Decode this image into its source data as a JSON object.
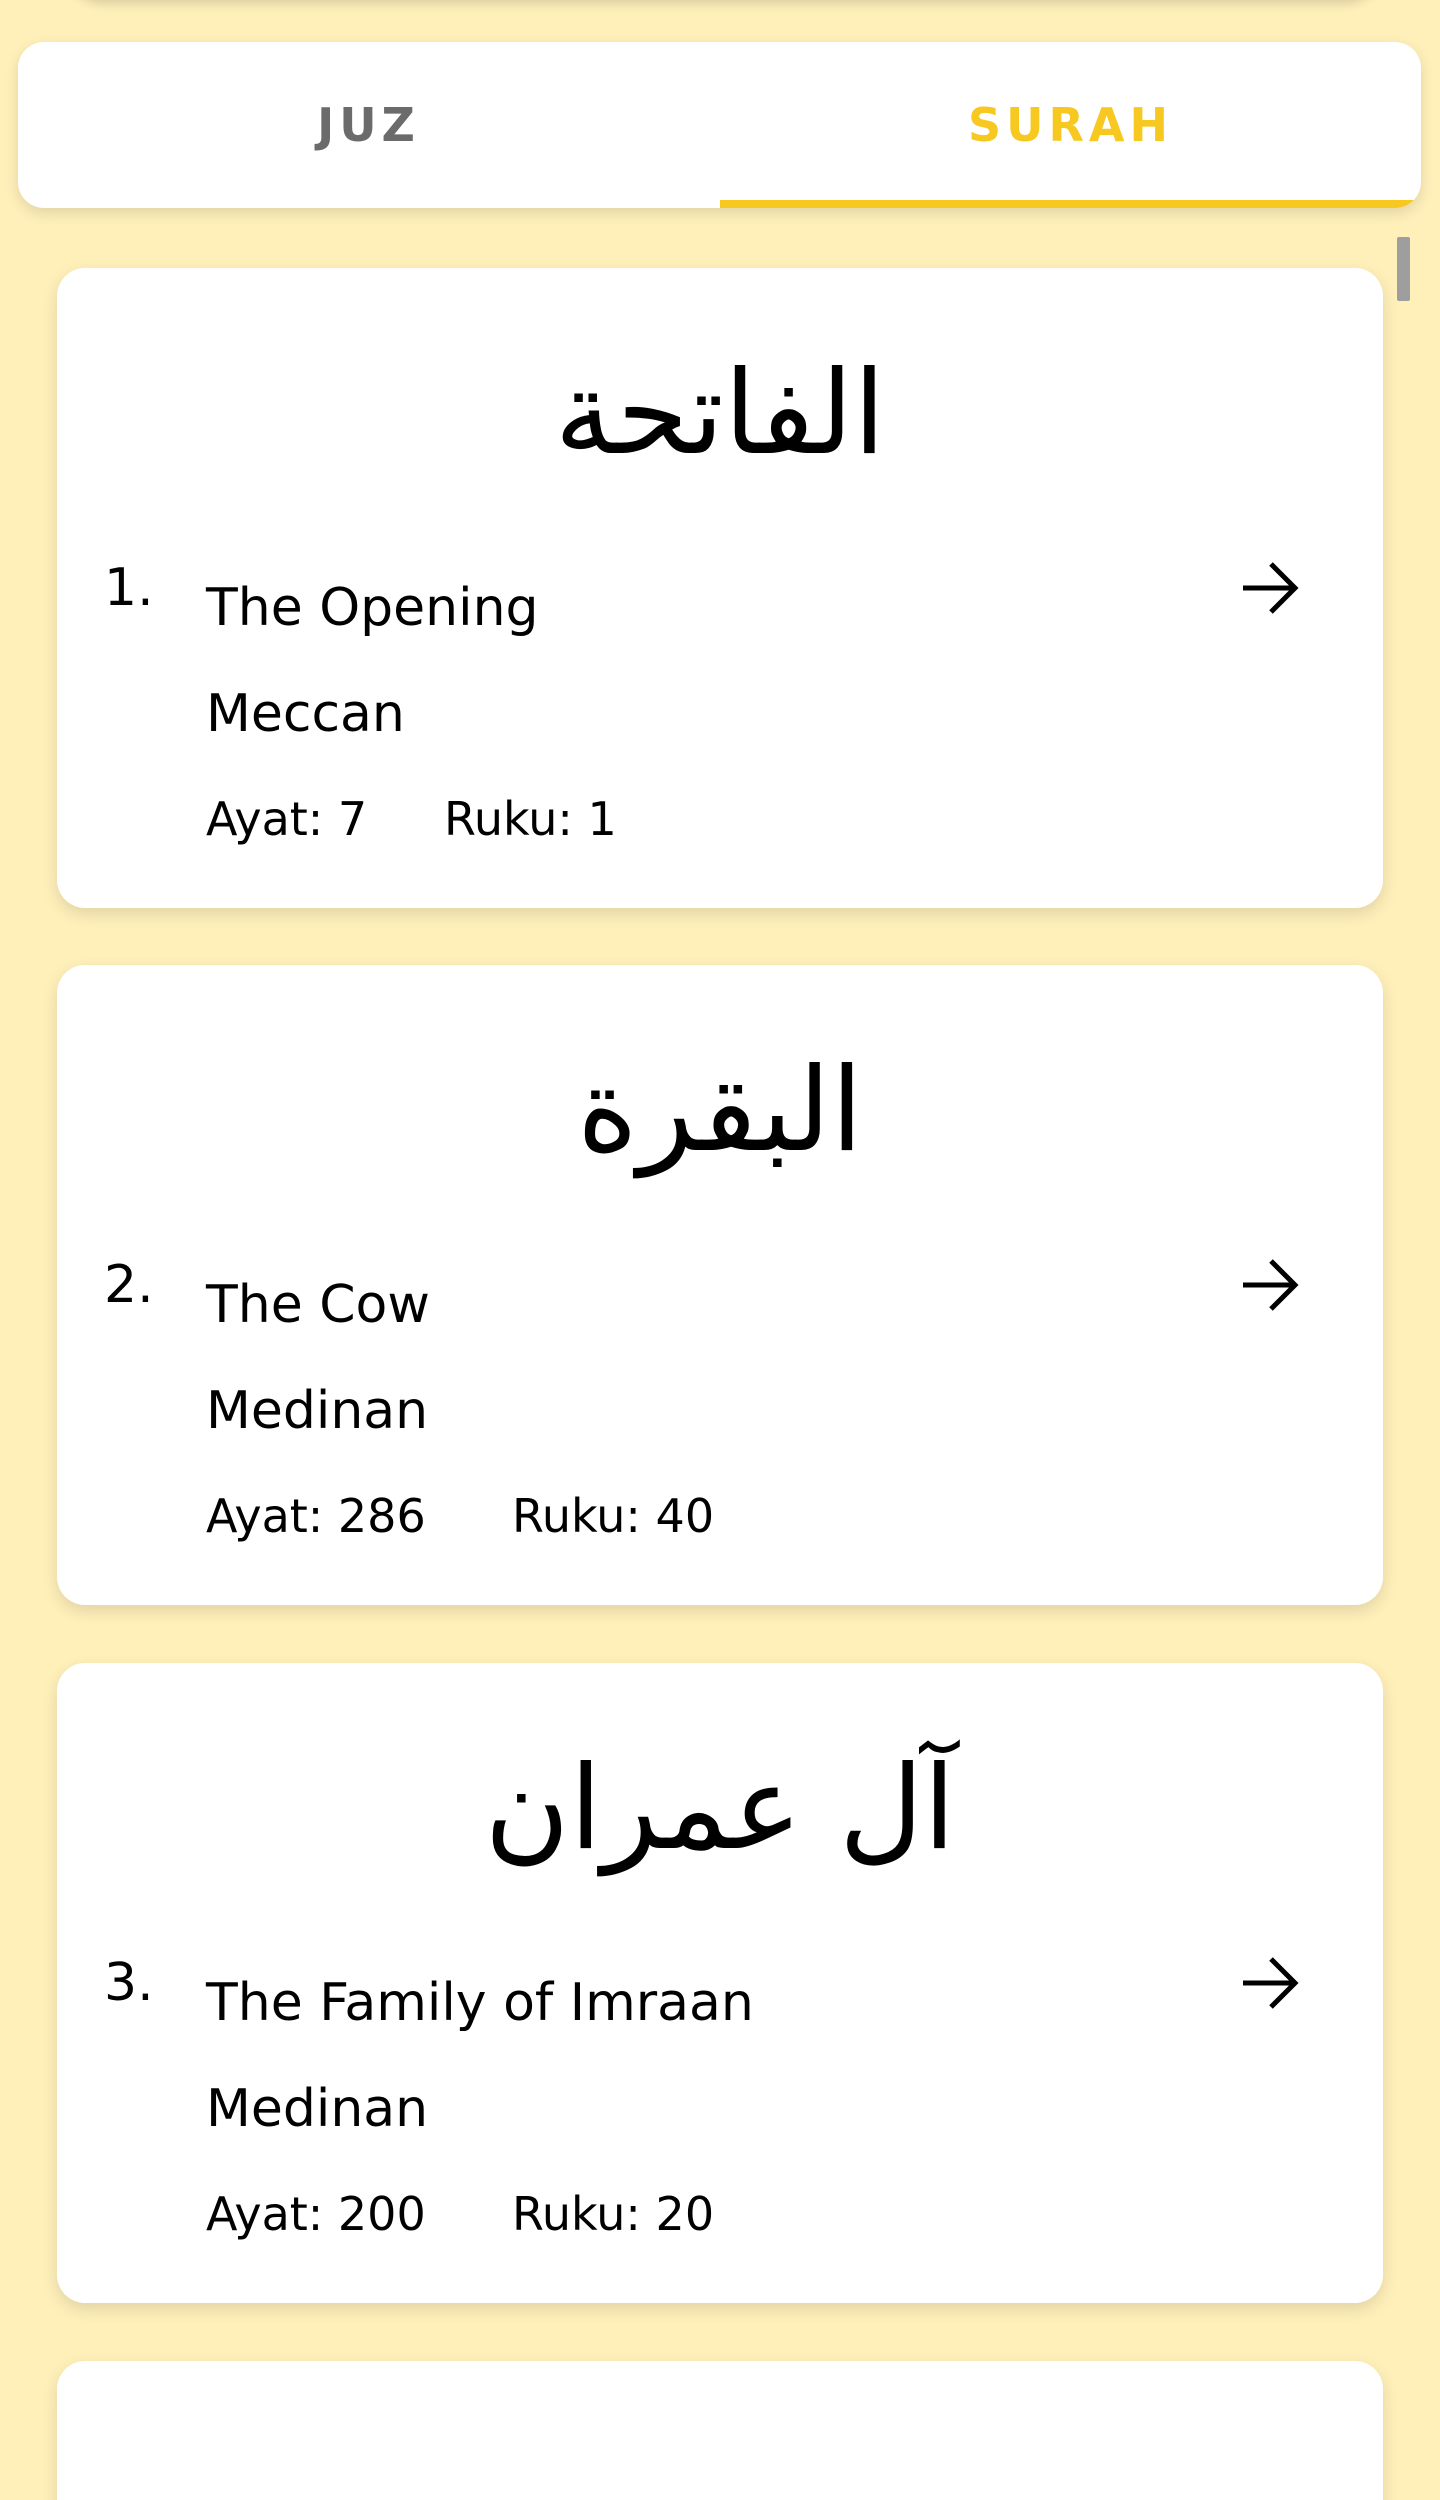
{
  "tabs": [
    {
      "label": "JUZ",
      "selected": false
    },
    {
      "label": "SURAH",
      "selected": true
    }
  ],
  "colors": {
    "background": "#FFF0BA",
    "accent": "#F7C81F",
    "inactive_tab": "#6B6B6B",
    "card": "#FFFFFF"
  },
  "surahs": [
    {
      "arabic": "الفاتحة",
      "number": "1.",
      "english": "The Opening",
      "type": "Meccan",
      "ayat": "Ayat: 7",
      "ruku": "Ruku: 1",
      "icon": "arrow-right-icon"
    },
    {
      "arabic": "البقرة",
      "number": "2.",
      "english": "The Cow",
      "type": "Medinan",
      "ayat": "Ayat: 286",
      "ruku": "Ruku: 40",
      "icon": "arrow-right-icon"
    },
    {
      "arabic": "آل عمران",
      "number": "3.",
      "english": "The Family of Imraan",
      "type": "Medinan",
      "ayat": "Ayat: 200",
      "ruku": "Ruku: 20",
      "icon": "arrow-right-icon"
    }
  ]
}
